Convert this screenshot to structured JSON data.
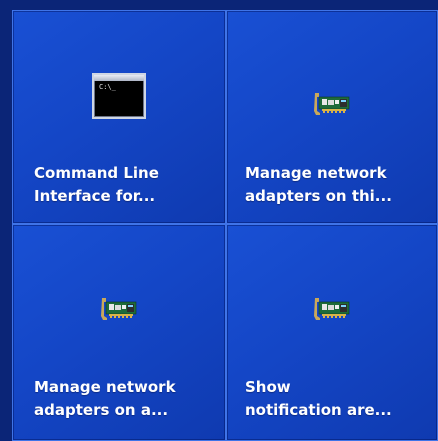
{
  "tiles": [
    {
      "icon": "command-prompt-icon",
      "line1": "Command Line",
      "line2": "Interface for...",
      "prompt_text": "C:\\_"
    },
    {
      "icon": "network-adapter-icon",
      "line1": "Manage network",
      "line2": "adapters on thi..."
    },
    {
      "icon": "network-adapter-icon",
      "line1": "Manage network",
      "line2": "adapters on a..."
    },
    {
      "icon": "network-adapter-icon",
      "line1": "Show",
      "line2": "notification are..."
    }
  ],
  "colors": {
    "tile_bg": "#1446c6",
    "tile_border": "#3f74e8",
    "page_bg": "#0a2a8c",
    "text": "#ffffff"
  }
}
